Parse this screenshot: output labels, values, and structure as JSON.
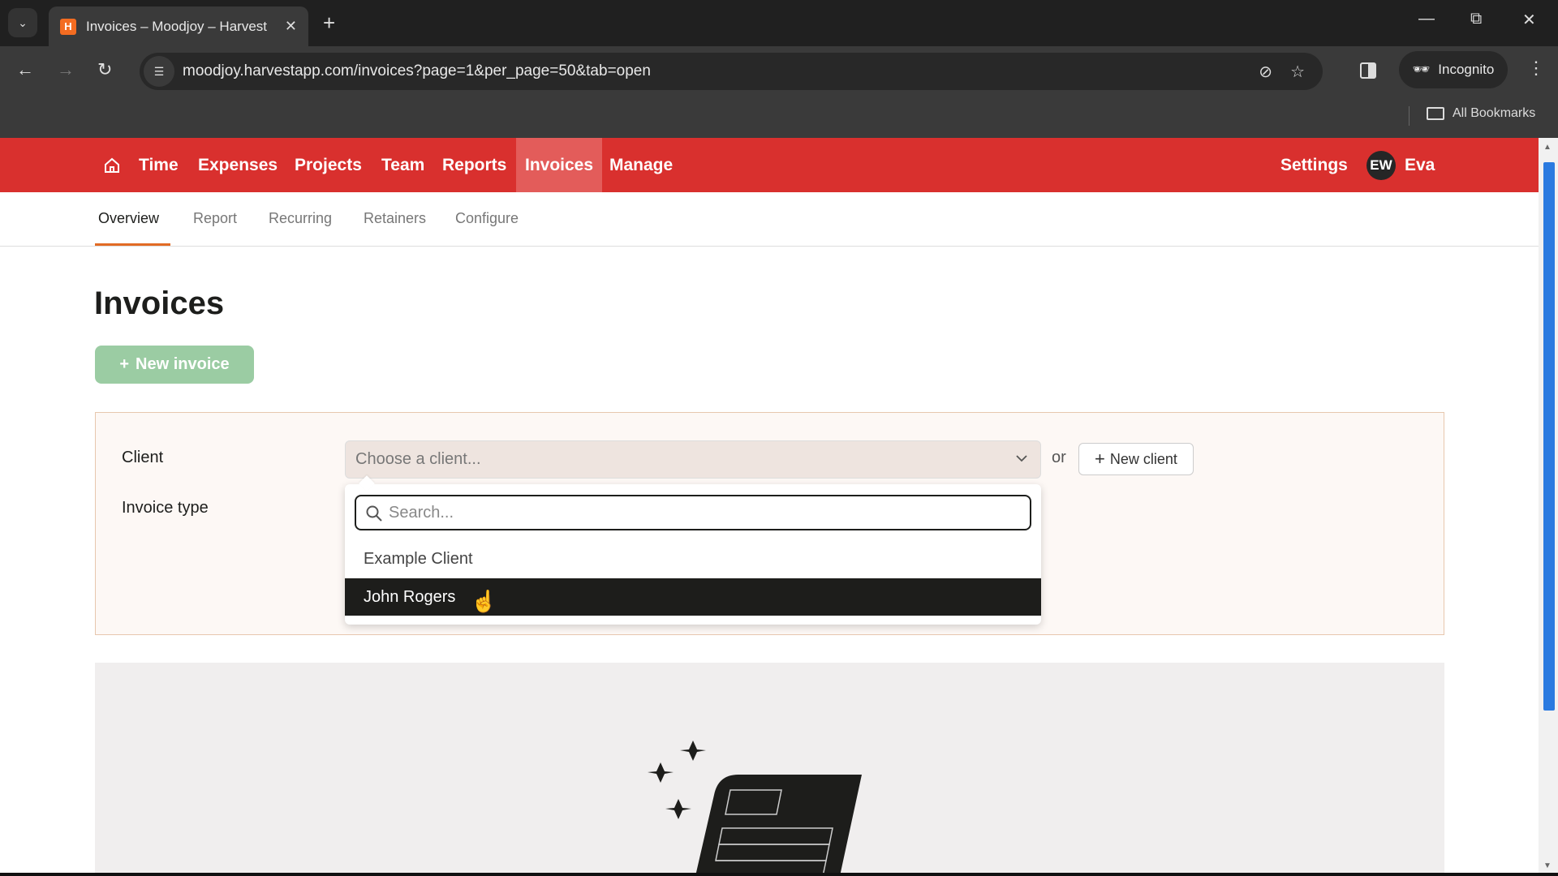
{
  "browser": {
    "tab_title": "Invoices – Moodjoy – Harvest",
    "favicon_letter": "H",
    "url": "moodjoy.harvestapp.com/invoices?page=1&per_page=50&tab=open",
    "incognito_label": "Incognito",
    "bookmarks_label": "All Bookmarks"
  },
  "app_nav": {
    "items": [
      "Time",
      "Expenses",
      "Projects",
      "Team",
      "Reports",
      "Invoices",
      "Manage"
    ],
    "active": "Invoices",
    "settings_label": "Settings",
    "avatar_initials": "EW",
    "user_name": "Eva"
  },
  "sub_nav": {
    "items": [
      "Overview",
      "Report",
      "Recurring",
      "Retainers",
      "Configure"
    ],
    "active": "Overview"
  },
  "page": {
    "title": "Invoices",
    "new_invoice_label": "New invoice"
  },
  "form": {
    "client_label": "Client",
    "invoice_type_label": "Invoice type",
    "client_placeholder": "Choose a client...",
    "or_text": "or",
    "new_client_label": "New client",
    "dropdown": {
      "search_placeholder": "Search...",
      "options": [
        "Example Client",
        "John Rogers"
      ],
      "highlighted": "John Rogers"
    }
  },
  "colors": {
    "brand_red": "#d9302e",
    "active_nav": "#e35c5a",
    "new_invoice_green": "#9bcca3",
    "tab_underline": "#e26b25"
  }
}
